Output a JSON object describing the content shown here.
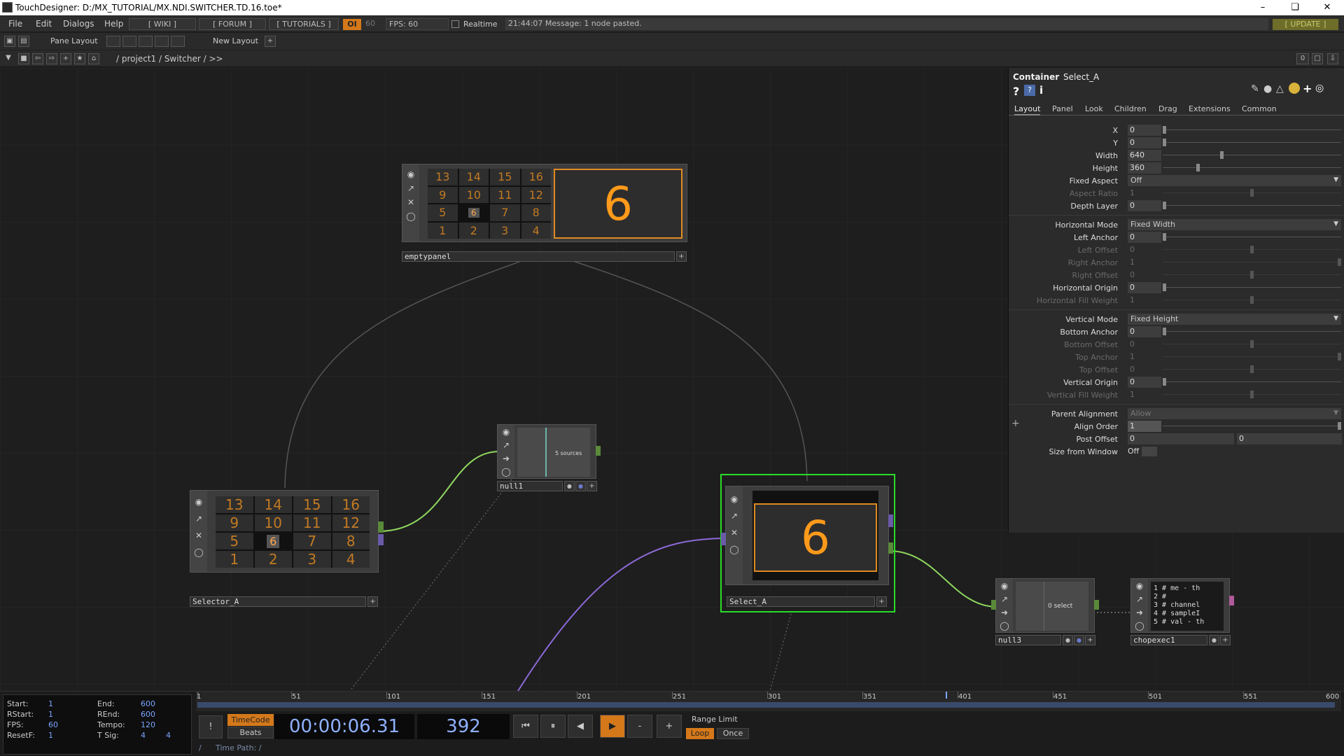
{
  "window": {
    "title": "TouchDesigner: D:/MX_TUTORIAL/MX.NDI.SWITCHER.TD.16.toe*",
    "minimize": "–",
    "maximize": "❏",
    "close": "✕"
  },
  "menubar": {
    "items": [
      "File",
      "Edit",
      "Dialogs",
      "Help"
    ],
    "wiki": "[ WIKI ]",
    "forum": "[ FORUM ]",
    "tutorials": "[ TUTORIALS ]",
    "perf": "OI",
    "fps_cap": "60",
    "fps": "FPS:  60",
    "realtime": "Realtime",
    "message": "21:44:07 Message: 1 node pasted.",
    "update": "[ UPDATE ]"
  },
  "toolbar": {
    "pane_layout": "Pane Layout",
    "new_layout": "New Layout",
    "add": "+"
  },
  "pathbar": {
    "path": "/ project1 / Switcher / >>",
    "right_num": "0"
  },
  "nodes": {
    "emptypanel": {
      "name": "emptypanel",
      "display": "6",
      "grid": [
        "13",
        "14",
        "15",
        "16",
        "9",
        "10",
        "11",
        "12",
        "5",
        "6",
        "7",
        "8",
        "1",
        "2",
        "3",
        "4"
      ],
      "selected": "6"
    },
    "selector": {
      "name": "Selector_A",
      "grid": [
        "13",
        "14",
        "15",
        "16",
        "9",
        "10",
        "11",
        "12",
        "5",
        "6",
        "7",
        "8",
        "1",
        "2",
        "3",
        "4"
      ],
      "selected": "6"
    },
    "null1": {
      "name": "null1",
      "content": "5 sources"
    },
    "select": {
      "name": "Select_A",
      "display": "6"
    },
    "null3": {
      "name": "null3",
      "content": "0 select"
    },
    "chopexec": {
      "name": "chopexec1",
      "lines": [
        "1  # me - th",
        "2  #",
        "3  # channel",
        "4  # sampleI",
        "5  # val - th"
      ]
    }
  },
  "params": {
    "type": "Container",
    "name": "Select_A",
    "tabs": [
      "Layout",
      "Panel",
      "Look",
      "Children",
      "Drag",
      "Extensions",
      "Common"
    ],
    "rows": [
      {
        "label": "X",
        "value": "0"
      },
      {
        "label": "Y",
        "value": "0"
      },
      {
        "label": "Width",
        "value": "640"
      },
      {
        "label": "Height",
        "value": "360"
      },
      {
        "label": "Fixed Aspect",
        "menu": "Off"
      },
      {
        "label": "Aspect Ratio",
        "value": "1"
      },
      {
        "label": "Depth Layer",
        "value": "0"
      },
      {
        "label": "Horizontal Mode",
        "menu": "Fixed Width"
      },
      {
        "label": "Left Anchor",
        "value": "0"
      },
      {
        "label": "Left Offset",
        "value": "0"
      },
      {
        "label": "Right Anchor",
        "value": "1"
      },
      {
        "label": "Right Offset",
        "value": "0"
      },
      {
        "label": "Horizontal Origin",
        "value": "0"
      },
      {
        "label": "Horizontal Fill Weight",
        "value": "1"
      },
      {
        "label": "Vertical Mode",
        "menu": "Fixed Height"
      },
      {
        "label": "Bottom Anchor",
        "value": "0"
      },
      {
        "label": "Bottom Offset",
        "value": "0"
      },
      {
        "label": "Top Anchor",
        "value": "1"
      },
      {
        "label": "Top Offset",
        "value": "0"
      },
      {
        "label": "Vertical Origin",
        "value": "0"
      },
      {
        "label": "Vertical Fill Weight",
        "value": "1"
      },
      {
        "label": "Parent Alignment",
        "menu": "Allow"
      },
      {
        "label": "Align Order",
        "value": "1"
      },
      {
        "label": "Post Offset",
        "value": "0",
        "value2": "0"
      },
      {
        "label": "Size from Window",
        "value": "Off"
      }
    ],
    "add_symbol": "+"
  },
  "timeline": {
    "info": {
      "start_k": "Start:",
      "start_v": "1",
      "end_k": "End:",
      "end_v": "600",
      "rstart_k": "RStart:",
      "rstart_v": "1",
      "rend_k": "REnd:",
      "rend_v": "600",
      "fps_k": "FPS:",
      "fps_v": "60",
      "tempo_k": "Tempo:",
      "tempo_v": "120",
      "resetf_k": "ResetF:",
      "resetf_v": "1",
      "tsig_k": "T Sig:",
      "tsig_v1": "4",
      "tsig_v2": "4"
    },
    "ticks": [
      "1",
      "51",
      "101",
      "151",
      "201",
      "251",
      "301",
      "351",
      "401",
      "451",
      "501",
      "551",
      "600"
    ],
    "timecode_btn": "TimeCode",
    "beats_btn": "Beats",
    "timecode": "00:00:06.31",
    "frame": "392",
    "range_limit": "Range Limit",
    "loop": "Loop",
    "once": "Once",
    "time_path": "Time Path: /",
    "left_btn": "!",
    "minus": "-",
    "plus": "+"
  }
}
